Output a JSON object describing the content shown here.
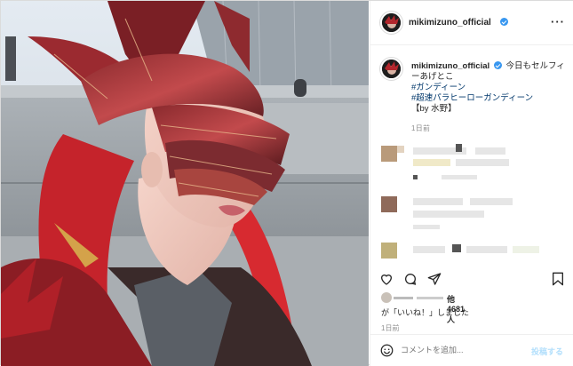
{
  "post": {
    "username": "mikimizuno_official",
    "more_icon": "more-horizontal-icon",
    "verified_icon": "verified-badge-icon",
    "photo_description_icon": "post-photo"
  },
  "caption": {
    "username": "mikimizuno_official",
    "text": "今日もセルフィーあげとこ",
    "tags": [
      "#ガンディーン",
      "#超速パラヒーローガンディーン"
    ],
    "signature": "【by 水野】",
    "time": "1日前"
  },
  "actions": {
    "like_icon": "heart-icon",
    "comment_icon": "comment-icon",
    "share_icon": "paper-plane-icon",
    "save_icon": "bookmark-icon"
  },
  "likes": {
    "line1_suffix": "他4681人",
    "line2": "が「いいね！」しました",
    "time": "1日前"
  },
  "comment": {
    "emoji_icon": "smiley-icon",
    "placeholder": "コメントを追加...",
    "post_label": "投稿する"
  },
  "colors": {
    "link": "#00376b",
    "verified": "#3897f0",
    "post_disabled": "#b2dffc",
    "muted": "#8e8e8e"
  }
}
